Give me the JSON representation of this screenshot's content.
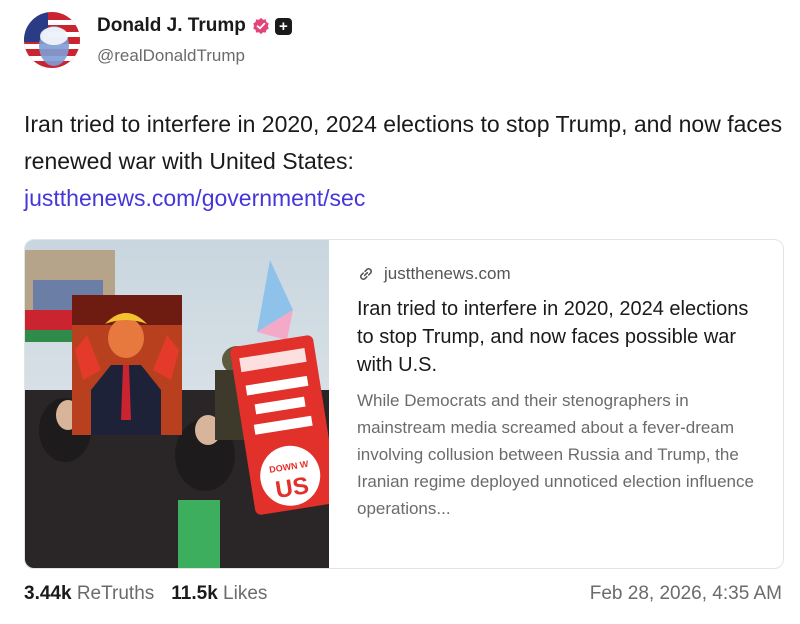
{
  "author": {
    "name": "Donald J. Trump",
    "handle": "@realDonaldTrump",
    "verified_color": "#e2457a"
  },
  "post": {
    "text": "Iran tried to interfere in 2020, 2024 elections to stop Trump, and now faces renewed war with United States:",
    "link": "justthenews.com/government/sec"
  },
  "card": {
    "domain": "justthenews.com",
    "title": "Iran tried to interfere in 2020, 2024 elections to stop Trump, and now faces possible war with U.S.",
    "description": "While Democrats and their stenographers in mainstream media screamed about a fever-dream involving collusion between Russia and Trump, the Iranian regime deployed unnoticed election influence operations...",
    "image_sign_text": "DOWN W US"
  },
  "stats": {
    "retruths_count": "3.44k",
    "retruths_label": "ReTruths",
    "likes_count": "11.5k",
    "likes_label": "Likes"
  },
  "timestamp": "Feb 28, 2026, 4:35 AM",
  "colors": {
    "link": "#4636d9",
    "muted": "#6b6b6b"
  }
}
